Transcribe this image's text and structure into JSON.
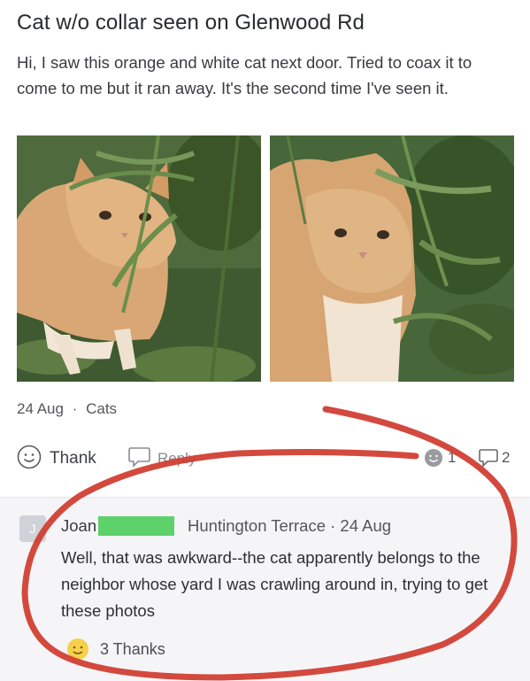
{
  "post": {
    "title": "Cat w/o collar seen on Glenwood Rd",
    "body": "Hi, I saw this orange and white cat next door. Tried to coax it to come to me but it ran away. It's the second time I've seen it.",
    "date": "24 Aug",
    "separator": "·",
    "category": "Cats"
  },
  "actions": {
    "thank_label": "Thank",
    "reply_label": "Reply",
    "reaction_count": "1",
    "comment_count": "2"
  },
  "comment": {
    "avatar_initial": "J",
    "author": "Joan",
    "location_time": "Huntington Terrace · 24 Aug",
    "text": "Well, that was awkward--the cat apparently belongs to the neighbor whose yard I was crawling around in, trying to get these photos",
    "thanks": "3 Thanks"
  },
  "colors": {
    "highlight_circle": "#cf3a2e",
    "redaction": "#5dd26a"
  }
}
